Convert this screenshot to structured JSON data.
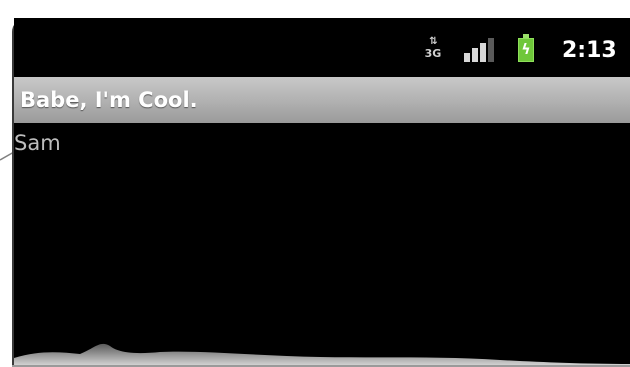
{
  "status_bar": {
    "network_icon": "3g-data-icon",
    "network_label": "3G",
    "signal_icon": "signal-strength-icon",
    "battery_icon": "battery-charging-icon",
    "time": "2:13"
  },
  "app": {
    "title": "Babe, I'm Cool."
  },
  "content": {
    "text": "Sam"
  },
  "colors": {
    "screen_bg": "#000000",
    "title_bar": "#b0b0b0",
    "title_text": "#ffffff",
    "content_text": "#bdbdbd",
    "battery": "#6fc73a"
  }
}
